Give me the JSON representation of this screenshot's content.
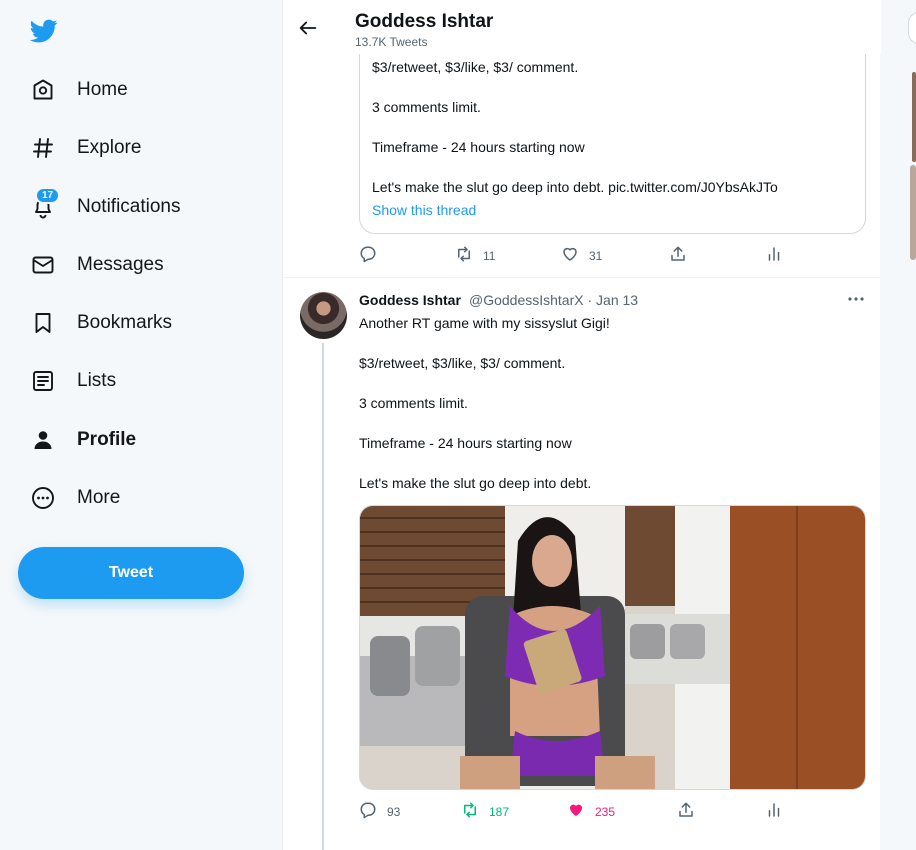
{
  "sidebar": {
    "logo_icon": "twitter-bird-icon",
    "items": [
      {
        "label": "Home",
        "icon": "home-icon"
      },
      {
        "label": "Explore",
        "icon": "hashtag-icon"
      },
      {
        "label": "Notifications",
        "icon": "bell-icon",
        "badge": "17"
      },
      {
        "label": "Messages",
        "icon": "envelope-icon"
      },
      {
        "label": "Bookmarks",
        "icon": "bookmark-icon"
      },
      {
        "label": "Lists",
        "icon": "list-icon"
      },
      {
        "label": "Profile",
        "icon": "person-icon"
      },
      {
        "label": "More",
        "icon": "more-circle-icon"
      }
    ],
    "tweet_button": "Tweet"
  },
  "header": {
    "name": "Goddess Ishtar",
    "tweet_count": "13.7K Tweets"
  },
  "quote": {
    "lines": [
      "$3/retweet, $3/like, $3/ comment.",
      " 3 comments limit.",
      "Timeframe - 24 hours starting now",
      "Let's make the slut go deep into debt. pic.twitter.com/J0YbsAkJTo"
    ],
    "show_thread": "Show this thread",
    "actions": {
      "replies": "",
      "retweets": "11",
      "likes": "31"
    }
  },
  "tweet": {
    "name": "Goddess Ishtar",
    "meta": "@GoddessIshtarX · Jan 13",
    "lines": [
      "Another RT game with my sissyslut Gigi!",
      "$3/retweet, $3/like, $3/ comment.",
      " 3 comments limit.",
      "Timeframe - 24 hours starting now",
      "Let's make the slut go deep into debt."
    ],
    "actions": {
      "replies": "93",
      "retweets": "187",
      "likes": "235"
    }
  },
  "colors": {
    "accent": "#1d9bf0",
    "retweet_active": "#00ba7c",
    "like_active": "#f91880"
  }
}
